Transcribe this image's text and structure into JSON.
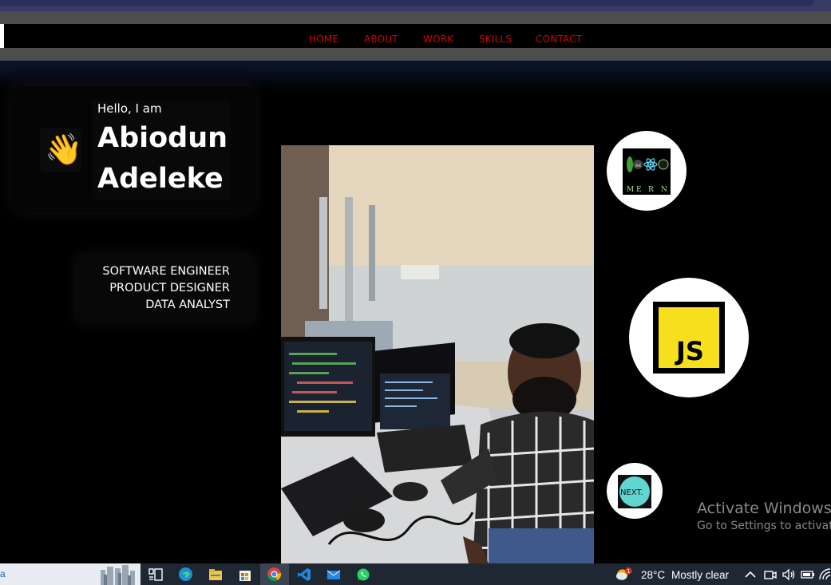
{
  "nav": {
    "items": [
      {
        "label": "HOME"
      },
      {
        "label": "ABOUT"
      },
      {
        "label": "WORK"
      },
      {
        "label": "SKILLS"
      },
      {
        "label": "CONTACT"
      }
    ],
    "color": "#d70000"
  },
  "hero": {
    "greeting": "Hello, I am",
    "first_name": "Abiodun",
    "last_name": "Adeleke",
    "wave_emoji": "👋",
    "roles": [
      "SOFTWARE ENGINEER",
      "PRODUCT DESIGNER",
      "DATA ANALYST"
    ]
  },
  "skills": {
    "mern_letters": [
      "M",
      "E",
      "R",
      "N"
    ],
    "js_label": "JS",
    "next_label": "NEXT."
  },
  "watermark": {
    "title": "Activate Windows",
    "subtitle": "Go to Settings to activate"
  },
  "taskbar": {
    "search_char": "a",
    "temperature": "28°C",
    "weather": "Mostly clear",
    "weather_badge": "1",
    "icons": [
      "task-view-icon",
      "edge-icon",
      "file-explorer-icon",
      "store-icon",
      "chrome-icon",
      "vscode-icon",
      "mail-icon",
      "whatsapp-icon"
    ]
  }
}
